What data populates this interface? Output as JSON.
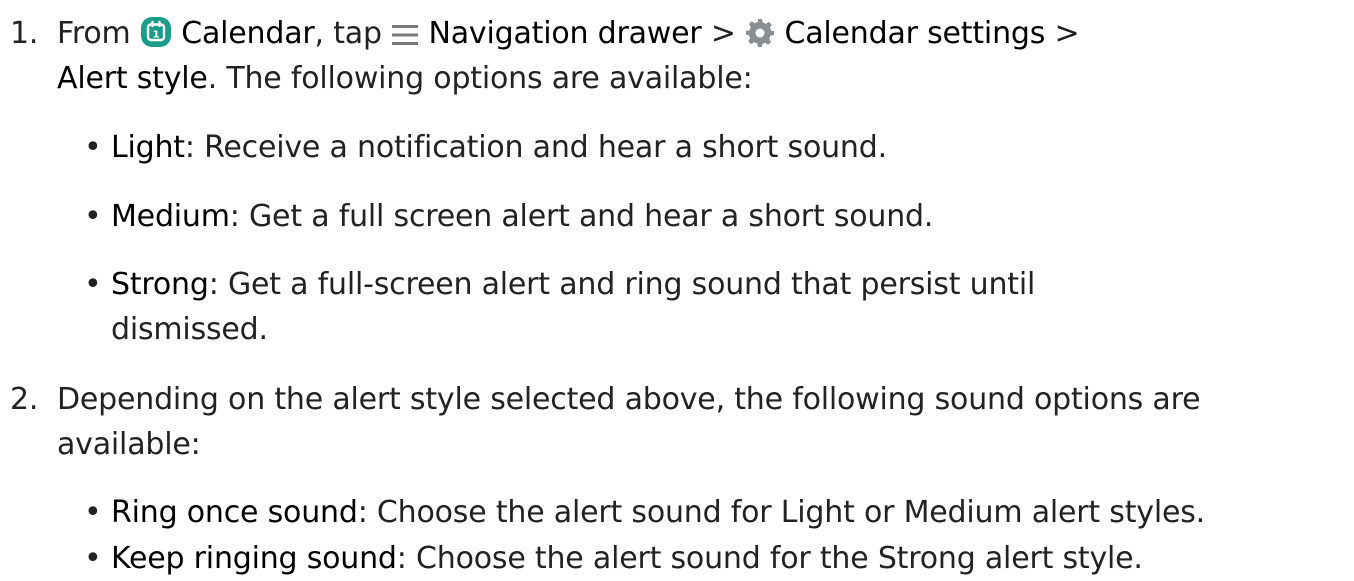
{
  "step1": {
    "number": "1.",
    "from": "From",
    "calendar_app": "Calendar",
    "tap": ", tap",
    "nav_drawer": "Navigation drawer",
    "sep1": ">",
    "calendar_settings": "Calendar settings",
    "sep2": ">",
    "alert_style": "Alert style",
    "intro_rest": ". The following options are available:",
    "calendar_icon_digit": "1",
    "bullets": [
      {
        "term": "Light",
        "text": ": Receive a notification and hear a short sound."
      },
      {
        "term": "Medium",
        "text": ": Get a full screen alert and hear a short sound."
      },
      {
        "term": "Strong",
        "text": ": Get a full-screen alert and ring sound that persist until",
        "text2": "dismissed."
      }
    ]
  },
  "step2": {
    "number": "2.",
    "line1": "Depending on the alert style selected above, the following sound options are",
    "line2": "available:",
    "bullets": [
      {
        "term": "Ring once sound",
        "text": ": Choose the alert sound for Light or Medium alert styles."
      },
      {
        "term": "Keep ringing sound",
        "text": ": Choose the alert sound for the Strong alert style."
      }
    ]
  },
  "icons": {
    "calendar": "calendar-app-icon",
    "menu": "hamburger-menu-icon",
    "gear": "gear-icon"
  },
  "colors": {
    "calendar_icon": "#1a9e8a",
    "menu_icon": "#7a7a7a",
    "gear_icon": "#8a8f93",
    "text": "#222222"
  }
}
